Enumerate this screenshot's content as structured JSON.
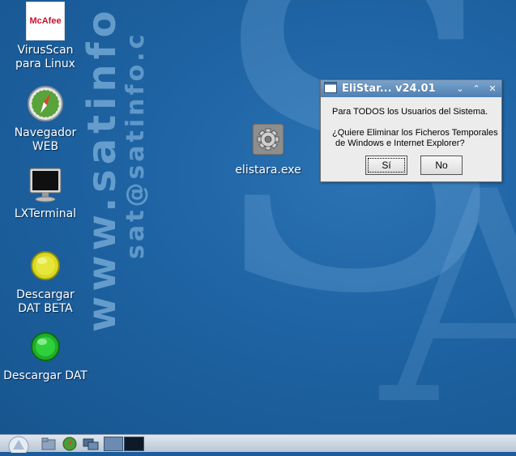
{
  "wallpaper": {
    "letter_s": "S",
    "letter_a": "A",
    "vertical_text_1": "www.satinfo",
    "vertical_text_2": "sat@satinfo.c"
  },
  "desktop_icons": [
    {
      "id": "virusscan",
      "label_line1": "VirusScan",
      "label_line2": "para Linux",
      "icon": "mcafee-logo",
      "logo_text": "McAfee"
    },
    {
      "id": "navegador",
      "label_line1": "Navegador",
      "label_line2": "WEB",
      "icon": "compass-icon"
    },
    {
      "id": "lxterminal",
      "label_line1": "LXTerminal",
      "label_line2": "",
      "icon": "monitor-icon"
    },
    {
      "id": "descargar-beta",
      "label_line1": "Descargar",
      "label_line2": "DAT BETA",
      "icon": "yellow-dot-icon"
    },
    {
      "id": "descargar-dat",
      "label_line1": "Descargar DAT",
      "label_line2": "",
      "icon": "green-dot-icon"
    },
    {
      "id": "elistara",
      "label_line1": "elistara.exe",
      "label_line2": "",
      "icon": "gear-icon"
    }
  ],
  "dialog": {
    "title": "EliStar... v24.01",
    "line1": "Para TODOS los Usuarios del Sistema.",
    "line2": "¿Quiere Eliminar los Ficheros Temporales",
    "line3": "de Windows e Internet Explorer?",
    "yes_label": "Sí",
    "no_label": "No"
  },
  "colors": {
    "desktop_bg": "#1e63a3",
    "dialog_bg": "#ececec",
    "titlebar": "#5a87b8",
    "taskbar": "#c9d3de"
  }
}
